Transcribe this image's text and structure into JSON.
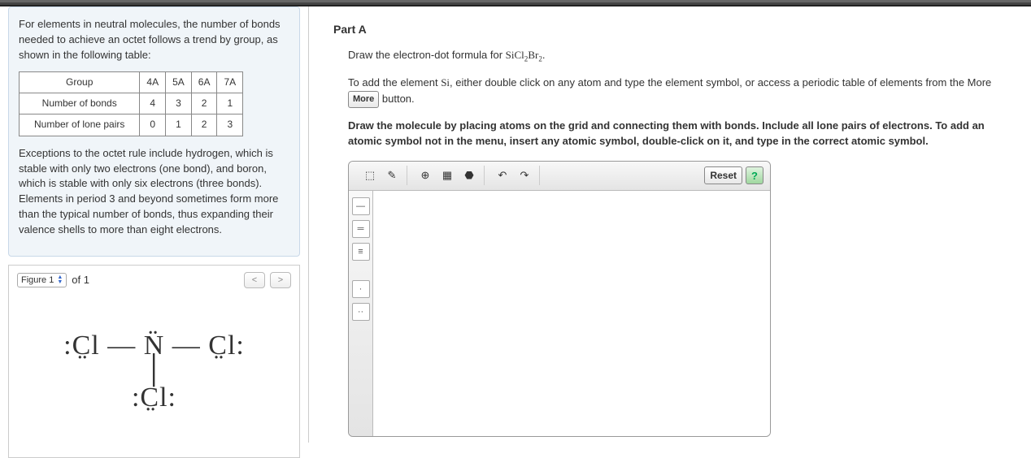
{
  "notes": {
    "intro": "For elements in neutral molecules, the number of bonds needed to achieve an octet follows a trend by group, as shown in the following table:",
    "table": {
      "group_label": "Group",
      "groups": [
        "4A",
        "5A",
        "6A",
        "7A"
      ],
      "bonds_label": "Number of bonds",
      "bonds": [
        "4",
        "3",
        "2",
        "1"
      ],
      "pairs_label": "Number of lone pairs",
      "pairs": [
        "0",
        "1",
        "2",
        "3"
      ]
    },
    "exceptions": "Exceptions to the octet rule include hydrogen, which is stable with only two electrons (one bond), and boron, which is stable with only six electrons (three bonds). Elements in period 3 and beyond sometimes form more than the typical number of bonds, thus expanding their valence shells to more than eight electrons."
  },
  "figure": {
    "label": "Figure 1",
    "of_text": "of 1"
  },
  "partA": {
    "title": "Part A",
    "q_prefix": "Draw the electron-dot formula for ",
    "formula_html": "SiCl₂Br₂",
    "q_suffix": ".",
    "add_prefix": "To add the element ",
    "si": "Si",
    "add_mid": ", either double click on any atom and type the element symbol, or access a periodic table of elements from the More ",
    "more_label": "More",
    "button_word": " button.",
    "bold": "Draw the molecule by placing atoms on the grid and connecting them with bonds. Include all lone pairs of electrons. To add an atomic symbol not in the menu, insert any atomic symbol, double-click on it, and type in the correct atomic symbol.",
    "reset": "Reset",
    "help": "?"
  }
}
